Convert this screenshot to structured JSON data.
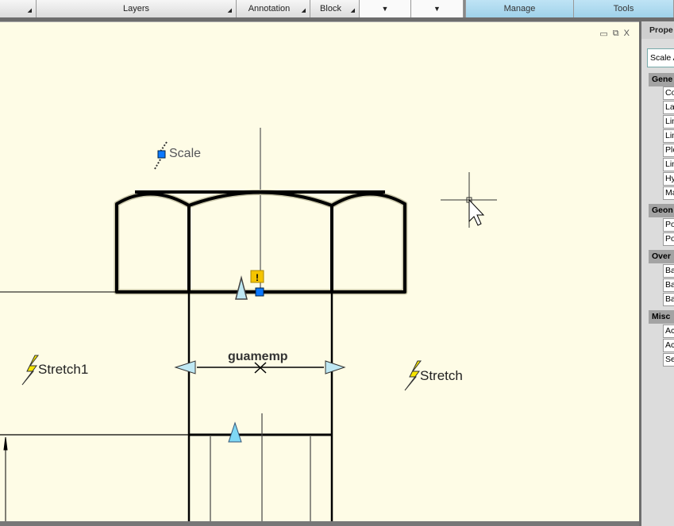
{
  "ribbon": {
    "panels": [
      {
        "label": ""
      },
      {
        "label": "Layers"
      },
      {
        "label": "Annotation"
      },
      {
        "label": "Block"
      },
      {
        "label": ""
      },
      {
        "label": ""
      }
    ],
    "tabs": [
      {
        "label": "Manage"
      },
      {
        "label": "Tools"
      }
    ],
    "dropdown_icon": "▼",
    "expand_icon": "◢"
  },
  "window_controls": {
    "minimize": "▭",
    "restore": "⧉",
    "close": "X"
  },
  "drawing": {
    "labels": {
      "scale": "Scale",
      "stretch1": "Stretch1",
      "stretch": "Stretch",
      "distance": "guamemp"
    },
    "colors": {
      "background": "#fefce6",
      "grip": "#0a78ff",
      "warning": "#f5c400",
      "lightning": "#f7e600",
      "arrow_grip": "#7fd8f5"
    }
  },
  "properties": {
    "title": "Prope",
    "selector": "Scale A",
    "groups": [
      {
        "label": "Gene",
        "rows": [
          "Co",
          "La",
          "Lin",
          "Lin",
          "Plo",
          "Lin",
          "Hy",
          "Ma"
        ]
      },
      {
        "label": "Geon",
        "rows": [
          "Po",
          "Po"
        ]
      },
      {
        "label": "Over",
        "rows": [
          "Ba",
          "Ba",
          "Ba"
        ]
      },
      {
        "label": "Misc",
        "rows": [
          "Ac",
          "Ac",
          "Se"
        ]
      }
    ]
  }
}
